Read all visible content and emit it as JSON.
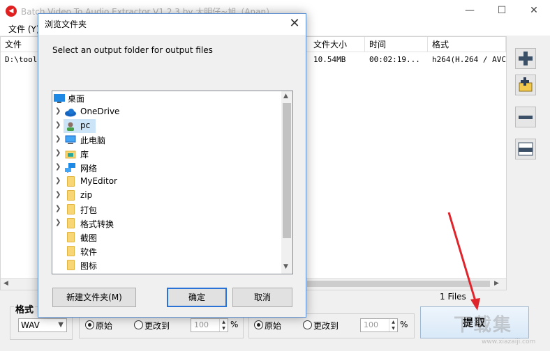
{
  "window": {
    "title": "Batch Video To Audio Extractor V1.2.3 by 大明仔~旭（Anan）",
    "minimize": "—",
    "maximize": "☐",
    "close": "✕"
  },
  "menu": [
    "文件 (Y)"
  ],
  "file_list": {
    "columns": [
      "文件",
      "文件大小",
      "时间",
      "格式"
    ],
    "rows": [
      {
        "file": "D:\\tool",
        "size": "10.54MB",
        "time": "00:02:19...",
        "format": "h264(H.264 / AVC"
      }
    ],
    "count": "1 Files"
  },
  "side_buttons": {
    "add": "add-icon",
    "add_folder": "add-folder-icon",
    "remove": "remove-icon",
    "clear": "clear-icon"
  },
  "bottom": {
    "format_label": "格式",
    "format_value": "WAV",
    "group1": {
      "original": "原始",
      "change": "更改到",
      "value": "100",
      "unit": "%"
    },
    "group2": {
      "original": "原始",
      "change": "更改到",
      "value": "100",
      "unit": "%"
    },
    "extract": "提取"
  },
  "dialog": {
    "title": "浏览文件夹",
    "close": "✕",
    "instruction": "Select an output folder for output files",
    "tree": [
      {
        "label": "桌面",
        "icon": "desktop-icon",
        "expandable": false
      },
      {
        "label": "OneDrive",
        "icon": "cloud-icon",
        "expandable": true
      },
      {
        "label": "pc",
        "icon": "user-icon",
        "expandable": true,
        "selected": true
      },
      {
        "label": "此电脑",
        "icon": "computer-icon",
        "expandable": true
      },
      {
        "label": "库",
        "icon": "library-icon",
        "expandable": true
      },
      {
        "label": "网络",
        "icon": "network-icon",
        "expandable": true
      },
      {
        "label": "MyEditor",
        "icon": "folder-icon",
        "expandable": true
      },
      {
        "label": "zip",
        "icon": "folder-icon",
        "expandable": true
      },
      {
        "label": "打包",
        "icon": "folder-icon",
        "expandable": true
      },
      {
        "label": "格式转换",
        "icon": "folder-icon",
        "expandable": true
      },
      {
        "label": "截图",
        "icon": "folder-icon",
        "expandable": false
      },
      {
        "label": "软件",
        "icon": "folder-icon",
        "expandable": false
      },
      {
        "label": "图标",
        "icon": "folder-icon",
        "expandable": false
      }
    ],
    "new_folder": "新建文件夹(M)",
    "ok": "确定",
    "cancel": "取消"
  },
  "watermark": {
    "text": "下载集",
    "url": "www.xiazaiji.com"
  },
  "colors": {
    "accent": "#2a72d6",
    "arrow": "#e0242c",
    "dialog_border": "#5c8ed0"
  }
}
